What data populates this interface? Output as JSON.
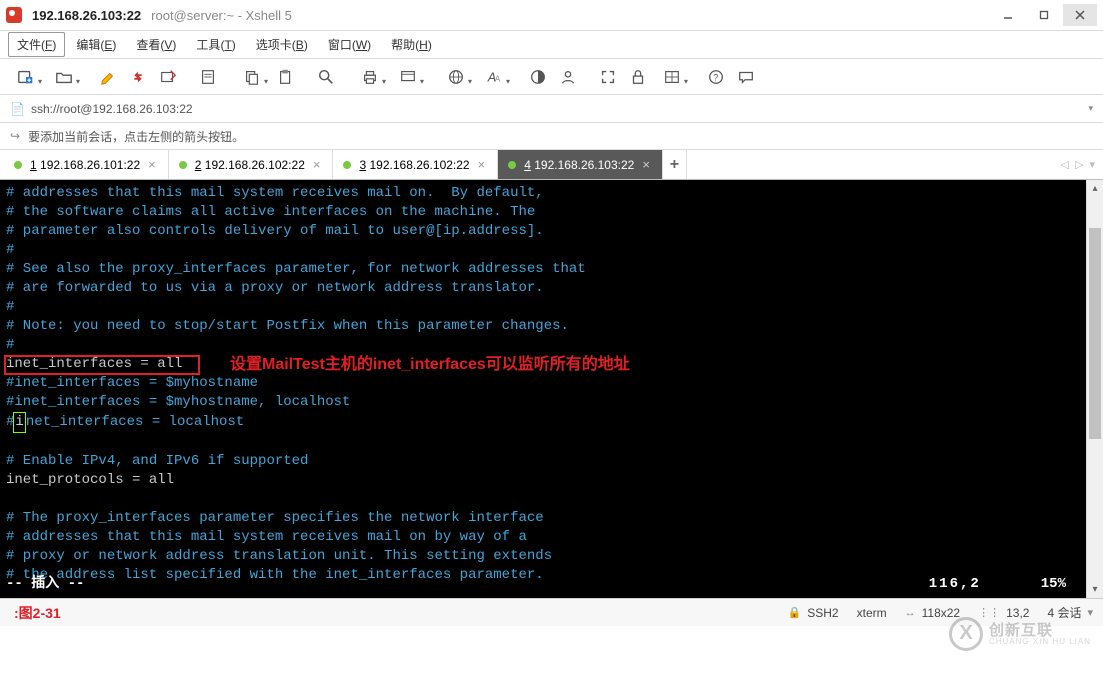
{
  "title": {
    "host": "192.168.26.103:22",
    "subtitle": "root@server:~ - Xshell 5"
  },
  "menu": {
    "file": {
      "label": "文件",
      "accel": "F"
    },
    "edit": {
      "label": "编辑",
      "accel": "E"
    },
    "view": {
      "label": "查看",
      "accel": "V"
    },
    "tools": {
      "label": "工具",
      "accel": "T"
    },
    "tabs": {
      "label": "选项卡",
      "accel": "B"
    },
    "window": {
      "label": "窗口",
      "accel": "W"
    },
    "help": {
      "label": "帮助",
      "accel": "H"
    }
  },
  "addressbar": {
    "url": "ssh://root@192.168.26.103:22"
  },
  "hintbar": {
    "text": "要添加当前会话，点击左侧的箭头按钮。"
  },
  "tabs": [
    {
      "num": "1",
      "label": "192.168.26.101:22",
      "active": false
    },
    {
      "num": "2",
      "label": "192.168.26.102:22",
      "active": false
    },
    {
      "num": "3",
      "label": "192.168.26.102:22",
      "active": false
    },
    {
      "num": "4",
      "label": "192.168.26.103:22",
      "active": true
    }
  ],
  "terminal": {
    "lines": [
      {
        "t": "comment",
        "text": "# addresses that this mail system receives mail on.  By default,"
      },
      {
        "t": "comment",
        "text": "# the software claims all active interfaces on the machine. The"
      },
      {
        "t": "comment",
        "text": "# parameter also controls delivery of mail to user@[ip.address]."
      },
      {
        "t": "comment",
        "text": "#"
      },
      {
        "t": "comment",
        "text": "# See also the proxy_interfaces parameter, for network addresses that"
      },
      {
        "t": "comment",
        "text": "# are forwarded to us via a proxy or network address translator."
      },
      {
        "t": "comment",
        "text": "#"
      },
      {
        "t": "comment",
        "text": "# Note: you need to stop/start Postfix when this parameter changes."
      },
      {
        "t": "comment",
        "text": "#"
      },
      {
        "t": "code",
        "text": "inet_interfaces = all"
      },
      {
        "t": "comment",
        "text": "#inet_interfaces = $myhostname"
      },
      {
        "t": "comment",
        "text": "#inet_interfaces = $myhostname, localhost"
      },
      {
        "t": "cursor"
      },
      {
        "t": "blank",
        "text": ""
      },
      {
        "t": "comment",
        "text": "# Enable IPv4, and IPv6 if supported"
      },
      {
        "t": "code",
        "text": "inet_protocols = all"
      },
      {
        "t": "blank",
        "text": ""
      },
      {
        "t": "comment",
        "text": "# The proxy_interfaces parameter specifies the network interface"
      },
      {
        "t": "comment",
        "text": "# addresses that this mail system receives mail on by way of a"
      },
      {
        "t": "comment",
        "text": "# proxy or network address translation unit. This setting extends"
      },
      {
        "t": "comment",
        "text": "# the address list specified with the inet_interfaces parameter."
      }
    ],
    "cursor_line": {
      "pre": "#",
      "ch": "i",
      "post": "net_interfaces = localhost"
    },
    "annotation": "设置MailTest主机的inet_interfaces可以监听所有的地址",
    "status": {
      "mode": "-- 插入 --",
      "pos": "116,2",
      "pct": "15%"
    }
  },
  "bottom": {
    "figure": ":图2-31",
    "ssh": "SSH2",
    "termtype": "xterm",
    "size": "118x22",
    "cursor": "13,2",
    "sessions": "4 会话"
  },
  "watermark": {
    "cn": "创新互联",
    "en": "CHUANG XIN HU LIAN"
  }
}
